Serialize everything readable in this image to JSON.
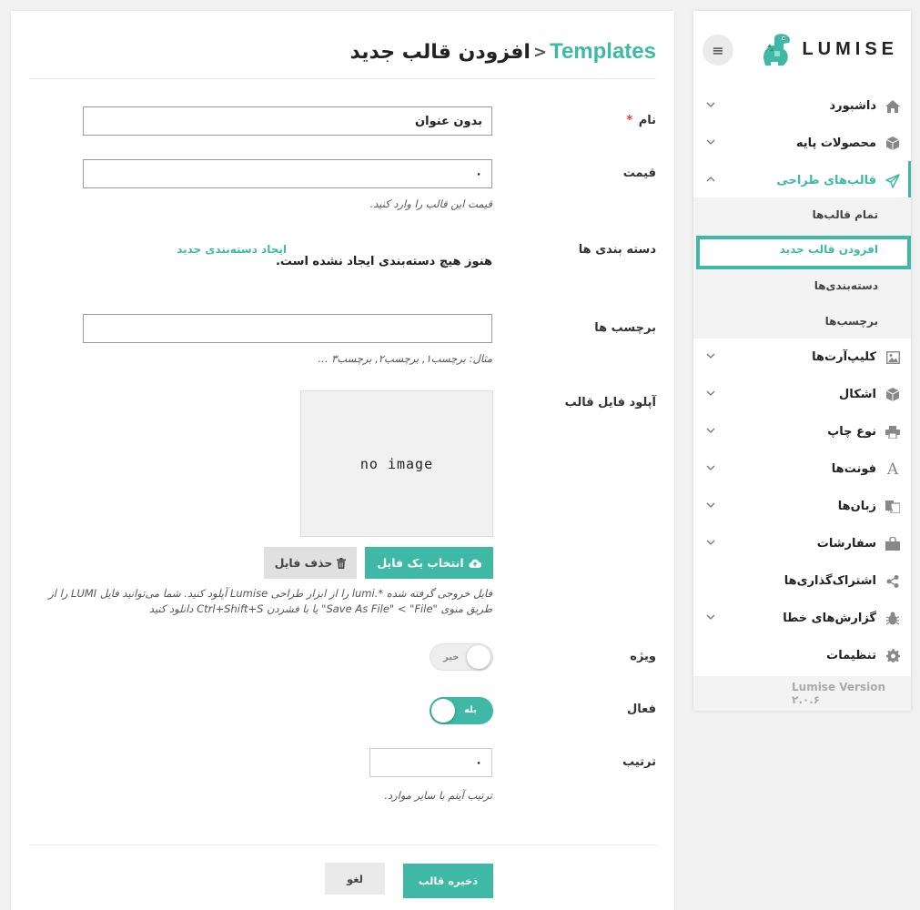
{
  "header": {
    "breadcrumb": "Templates",
    "separator": "<",
    "title": "افزودن قالب جدید"
  },
  "form": {
    "name_label": "نام",
    "required_mark": "*",
    "name_value": "بدون عنوان",
    "price_label": "قیمت",
    "price_value": "۰",
    "price_hint": "قیمت این قالب را وارد کنید.",
    "categories_label": "دسته بندی ها",
    "categories_empty": "هنوز هیچ دسته‌بندی ایجاد نشده است.",
    "categories_create_link": "ایجاد دسته‌بندی جدید",
    "tags_label": "برچسب ها",
    "tags_value": "",
    "tags_hint": "مثال: برچسب۱, برچسب۲, برچسب۳ ...",
    "upload_label": "آپلود فایل قالب",
    "no_image_text": "no image",
    "choose_file_button": "انتخاب یک فایل",
    "remove_file_button": "حذف فایل",
    "upload_hint": "فایل خروجی گرفته شده *.lumi را از ابزار طراحی Lumise آپلود کنید. شما می‌توانید فایل LUMI را از طریق منوی \"Save As File\" < \"File\" یا با فشردن Ctrl+Shift+S دانلود کنید",
    "featured_label": "ویژه",
    "featured_toggle_text": "خیر",
    "featured_on": false,
    "active_label": "فعال",
    "active_toggle_text": "بله",
    "active_on": true,
    "order_label": "ترتیب",
    "order_value": "۰",
    "order_hint": "ترتیب آیتم با سایر موارد.",
    "save_button": "ذخیره قالب",
    "cancel_button": "لغو"
  },
  "sidebar": {
    "logo_text": "LUMISE",
    "items": [
      {
        "label": "داشبورد",
        "icon": "home-icon",
        "chevron": "down"
      },
      {
        "label": "محصولات پایه",
        "icon": "cube-icon",
        "chevron": "down"
      },
      {
        "label": "قالب‌های طراحی",
        "icon": "paper-plane-icon",
        "chevron": "up"
      },
      {
        "label": "کلیپ‌آرت‌ها",
        "icon": "image-icon",
        "chevron": "down"
      },
      {
        "label": "اشکال",
        "icon": "cube-icon",
        "chevron": "down"
      },
      {
        "label": "نوع چاپ",
        "icon": "printer-icon",
        "chevron": "down"
      },
      {
        "label": "فونت‌ها",
        "icon": "font-icon",
        "chevron": "down"
      },
      {
        "label": "زبان‌ها",
        "icon": "language-icon",
        "chevron": "down"
      },
      {
        "label": "سفارشات",
        "icon": "shopping-bag-icon",
        "chevron": "down"
      },
      {
        "label": "اشتراک‌گذاری‌ها",
        "icon": "share-icon",
        "chevron": ""
      },
      {
        "label": "گزارش‌های خطا",
        "icon": "bug-icon",
        "chevron": "down"
      },
      {
        "label": "تنظیمات",
        "icon": "gear-icon",
        "chevron": ""
      }
    ],
    "submenu": [
      {
        "label": "تمام قالب‌ها"
      },
      {
        "label": "افزودن قالب جدید"
      },
      {
        "label": "دسته‌بندی‌ها"
      },
      {
        "label": "برچسب‌ها"
      }
    ],
    "version": "Lumise Version ۲.۰.۶"
  },
  "colors": {
    "accent": "#3fb9a5",
    "required": "#ee3333"
  }
}
